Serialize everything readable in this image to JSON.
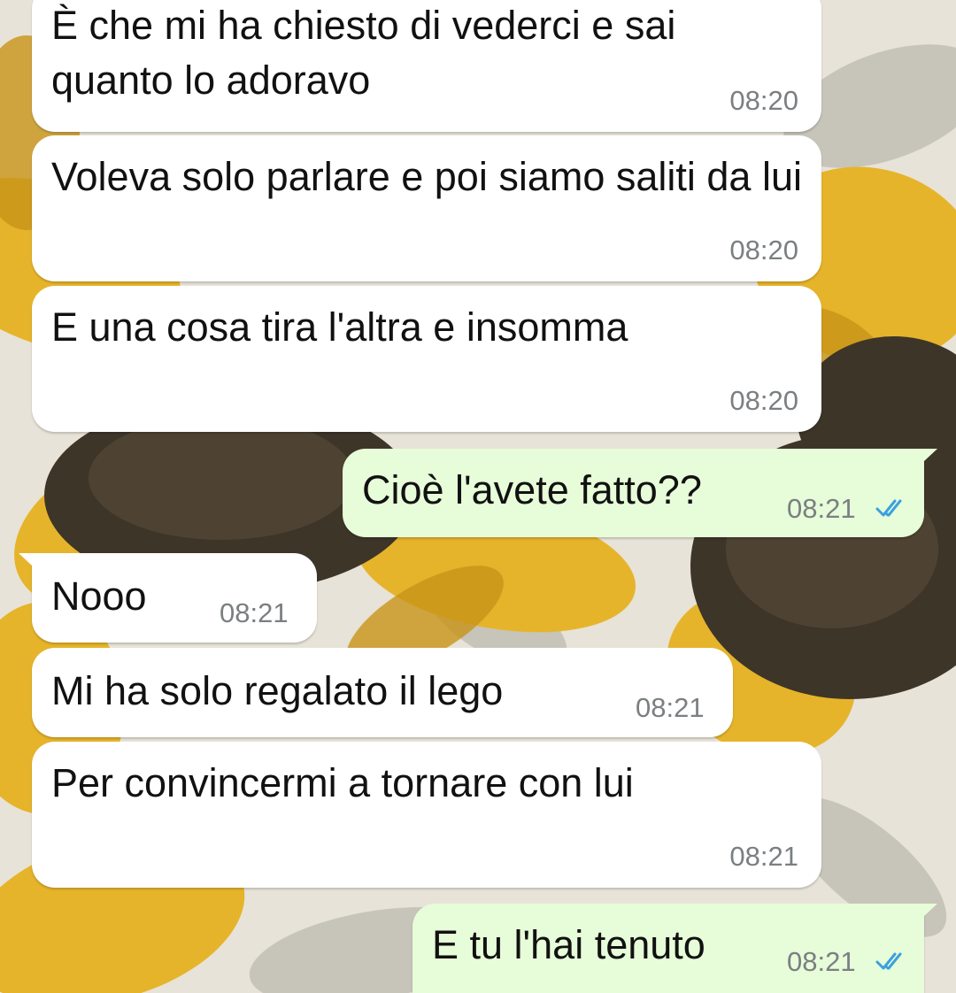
{
  "colors": {
    "incoming_bubble": "#ffffff",
    "outgoing_bubble": "#e7fcd8",
    "timestamp": "#7b7f82",
    "read_ticks": "#3ba1de"
  },
  "messages": [
    {
      "direction": "incoming",
      "text": "È che mi ha chiesto di vederci e sai quanto lo adoravo",
      "time": "08:20"
    },
    {
      "direction": "incoming",
      "text": "Voleva solo parlare e poi siamo saliti da lui",
      "time": "08:20"
    },
    {
      "direction": "incoming",
      "text": "E una cosa tira l'altra e insomma",
      "time": "08:20"
    },
    {
      "direction": "outgoing",
      "text": "Cioè l'avete fatto??",
      "time": "08:21",
      "status_icon": "double-check-read-icon"
    },
    {
      "direction": "incoming",
      "text": "Nooo",
      "time": "08:21"
    },
    {
      "direction": "incoming",
      "text": "Mi ha solo regalato il lego",
      "time": "08:21"
    },
    {
      "direction": "incoming",
      "text": "Per convincermi a tornare con lui",
      "time": "08:21"
    },
    {
      "direction": "outgoing",
      "text": "E tu l'hai tenuto",
      "time": "08:21",
      "status_icon": "double-check-read-icon"
    }
  ]
}
